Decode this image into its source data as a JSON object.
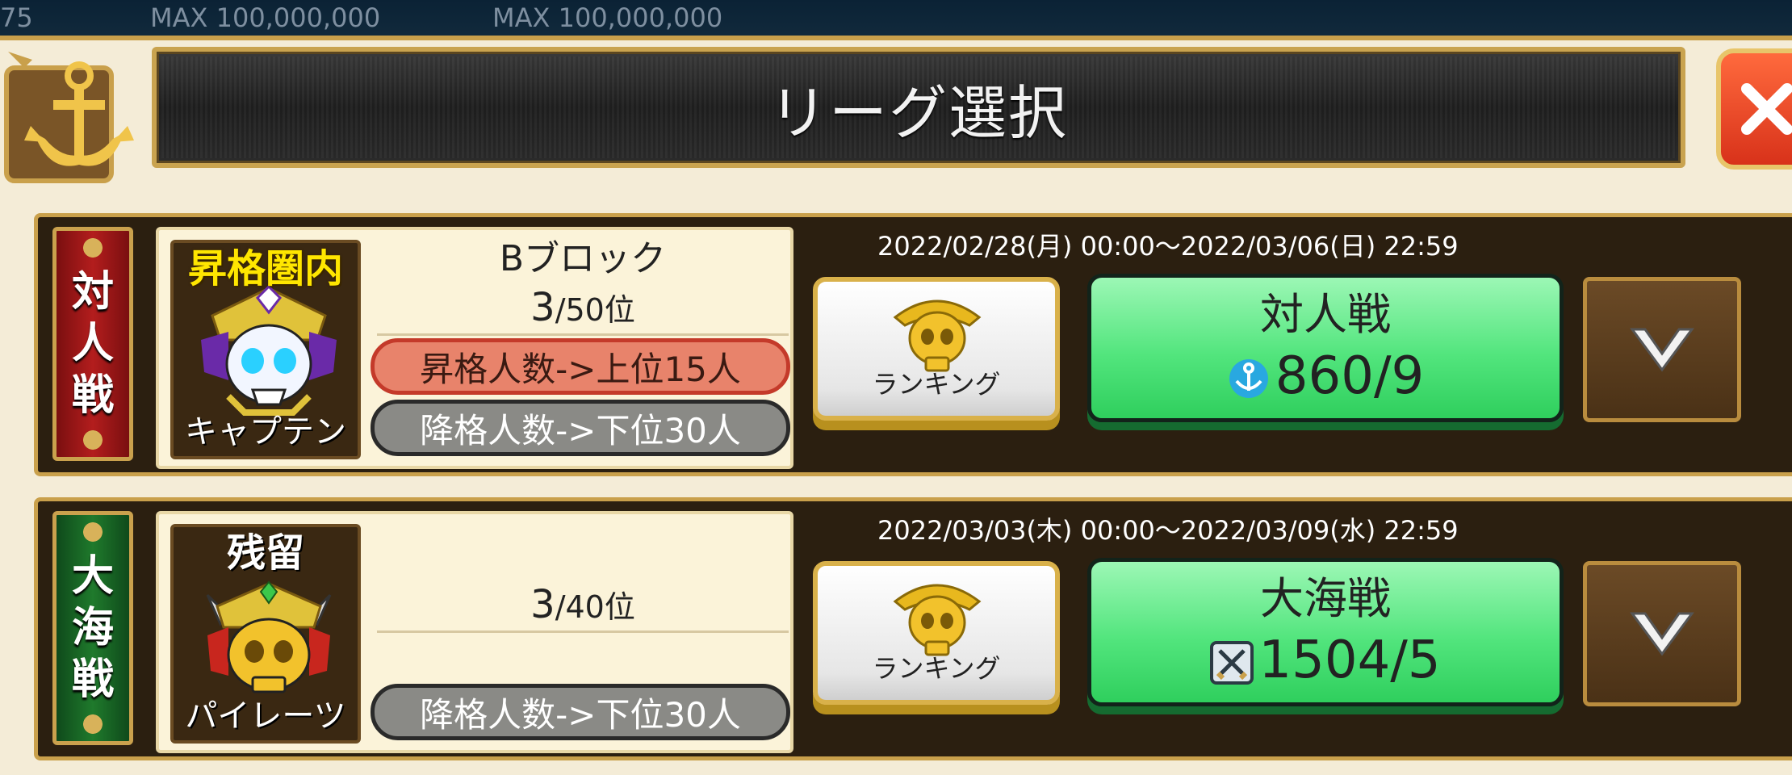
{
  "top_bar": {
    "left_fragment": "75",
    "max_1": "MAX 100,000,000",
    "max_2": "MAX 100,000,000"
  },
  "dialog": {
    "title": "リーグ選択",
    "close_icon": "close-x-icon"
  },
  "leagues": [
    {
      "banner": [
        "対",
        "人",
        "戦"
      ],
      "banner_color": "#b31d1d",
      "status": "昇格圏内",
      "rank_title": "キャプテン",
      "block": "Bブロック",
      "position": "3",
      "position_total": "/50位",
      "promotion_text": "昇格人数->上位15人",
      "demotion_text": "降格人数->下位30人",
      "period": "2022/02/28(月) 00:00～2022/03/06(日) 22:59",
      "ranking_label": "ランキング",
      "battle_name": "対人戦",
      "battle_score": "860/9",
      "score_icon": "anchor-icon"
    },
    {
      "banner": [
        "大",
        "海",
        "戦"
      ],
      "banner_color": "#1f7a2c",
      "status": "残留",
      "rank_title": "パイレーツ",
      "block": "",
      "position": "3",
      "position_total": "/40位",
      "promotion_text": "",
      "demotion_text": "降格人数->下位30人",
      "period": "2022/03/03(木) 00:00～2022/03/09(水) 22:59",
      "ranking_label": "ランキング",
      "battle_name": "大海戦",
      "battle_score": "1504/5",
      "score_icon": "crossed-swords-icon"
    }
  ]
}
